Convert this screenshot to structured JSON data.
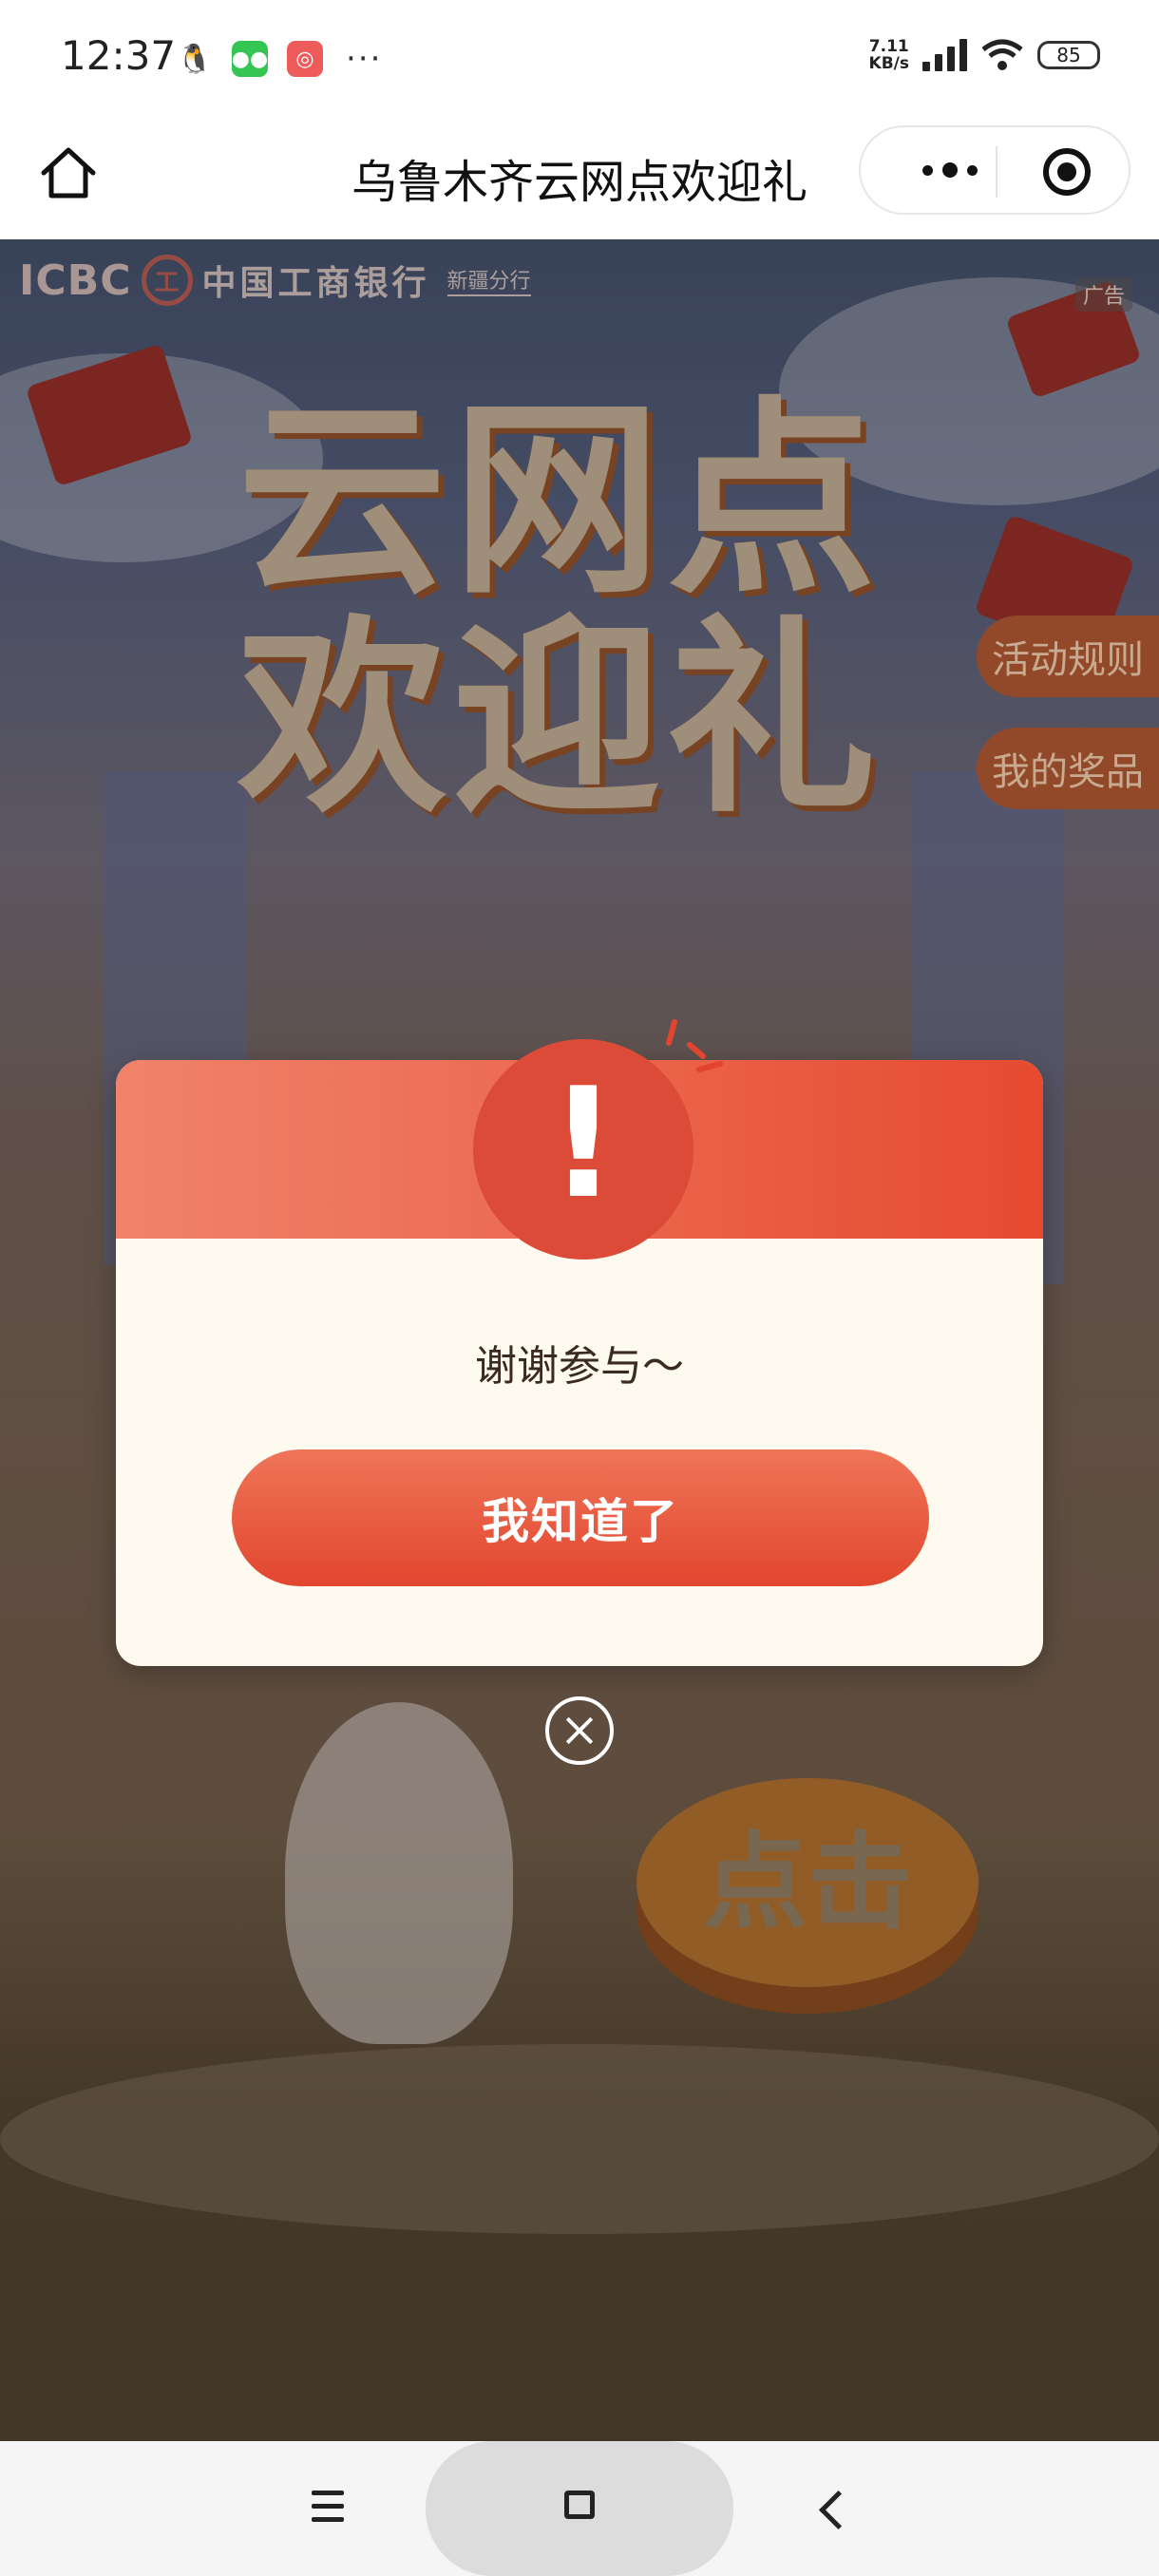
{
  "status_bar": {
    "time": "12:37",
    "net_speed_value": "7.11",
    "net_speed_unit": "KB/s",
    "battery": "85",
    "notification_icons": [
      "qq-icon",
      "wechat-icon",
      "red-app-icon"
    ],
    "more": "···"
  },
  "nav": {
    "title": "乌鲁木齐云网点欢迎礼"
  },
  "banner": {
    "brand_en": "ICBC",
    "brand_cn": "中国工商银行",
    "branch": "新疆分行",
    "ad_tag": "广告",
    "hero_line1": "云网点",
    "hero_line2": "欢迎礼",
    "rules_button": "活动规则",
    "prizes_button": "我的奖品",
    "click_label": "点击"
  },
  "modal": {
    "icon": "!",
    "message": "谢谢参与～",
    "confirm_button": "我知道了"
  },
  "colors": {
    "accent": "#e64a2f",
    "modal_bg": "#fffaf0",
    "header_start": "#f0836a"
  }
}
